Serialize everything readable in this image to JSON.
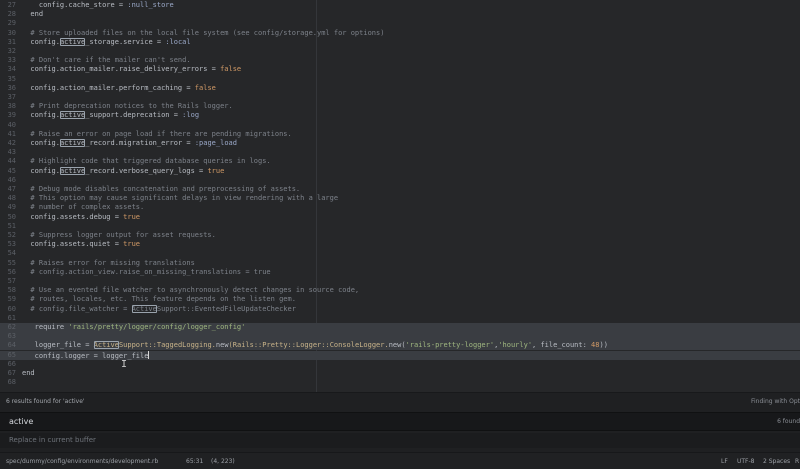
{
  "editor": {
    "lines": [
      {
        "num": "27",
        "tokens": [
          {
            "t": "    config.",
            "c": "c-default"
          },
          {
            "t": "cache_store",
            "c": "c-default"
          },
          {
            "t": " = ",
            "c": "c-default"
          },
          {
            "t": ":null_store",
            "c": "c-symbol"
          }
        ]
      },
      {
        "num": "28",
        "tokens": [
          {
            "t": "  end",
            "c": "c-default"
          }
        ]
      },
      {
        "num": "29",
        "tokens": []
      },
      {
        "num": "30",
        "tokens": [
          {
            "t": "  # Store uploaded files on the local file system (see config/storage.yml for options)",
            "c": "c-comment"
          }
        ]
      },
      {
        "num": "31",
        "tokens": [
          {
            "t": "  config.",
            "c": "c-default"
          },
          {
            "t": "active",
            "c": "c-default",
            "m": true
          },
          {
            "t": "_storage.service = ",
            "c": "c-default"
          },
          {
            "t": ":local",
            "c": "c-symbol"
          }
        ]
      },
      {
        "num": "32",
        "tokens": []
      },
      {
        "num": "33",
        "tokens": [
          {
            "t": "  # Don't care if the mailer can't send.",
            "c": "c-comment"
          }
        ]
      },
      {
        "num": "34",
        "tokens": [
          {
            "t": "  config.action_mailer.raise_delivery_errors = ",
            "c": "c-default"
          },
          {
            "t": "false",
            "c": "c-bool"
          }
        ]
      },
      {
        "num": "35",
        "tokens": []
      },
      {
        "num": "36",
        "tokens": [
          {
            "t": "  config.action_mailer.perform_caching = ",
            "c": "c-default"
          },
          {
            "t": "false",
            "c": "c-bool"
          }
        ]
      },
      {
        "num": "37",
        "tokens": []
      },
      {
        "num": "38",
        "tokens": [
          {
            "t": "  # Print deprecation notices to the Rails logger.",
            "c": "c-comment"
          }
        ]
      },
      {
        "num": "39",
        "tokens": [
          {
            "t": "  config.",
            "c": "c-default"
          },
          {
            "t": "active",
            "c": "c-default",
            "m": true
          },
          {
            "t": "_support.deprecation = ",
            "c": "c-default"
          },
          {
            "t": ":log",
            "c": "c-symbol"
          }
        ]
      },
      {
        "num": "40",
        "tokens": []
      },
      {
        "num": "41",
        "tokens": [
          {
            "t": "  # Raise an error on page load if there are pending migrations.",
            "c": "c-comment"
          }
        ]
      },
      {
        "num": "42",
        "tokens": [
          {
            "t": "  config.",
            "c": "c-default"
          },
          {
            "t": "active",
            "c": "c-default",
            "m": true
          },
          {
            "t": "_record.migration_error = ",
            "c": "c-default"
          },
          {
            "t": ":page_load",
            "c": "c-symbol"
          }
        ]
      },
      {
        "num": "43",
        "tokens": []
      },
      {
        "num": "44",
        "tokens": [
          {
            "t": "  # Highlight code that triggered database queries in logs.",
            "c": "c-comment"
          }
        ]
      },
      {
        "num": "45",
        "tokens": [
          {
            "t": "  config.",
            "c": "c-default"
          },
          {
            "t": "active",
            "c": "c-default",
            "m": true
          },
          {
            "t": "_record.verbose_query_logs = ",
            "c": "c-default"
          },
          {
            "t": "true",
            "c": "c-bool"
          }
        ]
      },
      {
        "num": "46",
        "tokens": []
      },
      {
        "num": "47",
        "tokens": [
          {
            "t": "  # Debug mode disables concatenation and preprocessing of assets.",
            "c": "c-comment"
          }
        ]
      },
      {
        "num": "48",
        "tokens": [
          {
            "t": "  # This option may cause significant delays in view rendering with a large",
            "c": "c-comment"
          }
        ]
      },
      {
        "num": "49",
        "tokens": [
          {
            "t": "  # number of complex assets.",
            "c": "c-comment"
          }
        ]
      },
      {
        "num": "50",
        "tokens": [
          {
            "t": "  config.assets.debug = ",
            "c": "c-default"
          },
          {
            "t": "true",
            "c": "c-bool"
          }
        ]
      },
      {
        "num": "51",
        "tokens": []
      },
      {
        "num": "52",
        "tokens": [
          {
            "t": "  # Suppress logger output for asset requests.",
            "c": "c-comment"
          }
        ]
      },
      {
        "num": "53",
        "tokens": [
          {
            "t": "  config.assets.quiet = ",
            "c": "c-default"
          },
          {
            "t": "true",
            "c": "c-bool"
          }
        ]
      },
      {
        "num": "54",
        "tokens": []
      },
      {
        "num": "55",
        "tokens": [
          {
            "t": "  # Raises error for missing translations",
            "c": "c-comment"
          }
        ]
      },
      {
        "num": "56",
        "tokens": [
          {
            "t": "  # config.action_view.raise_on_missing_translations = true",
            "c": "c-comment"
          }
        ]
      },
      {
        "num": "57",
        "tokens": []
      },
      {
        "num": "58",
        "tokens": [
          {
            "t": "  # Use an evented file watcher to asynchronously detect changes in source code,",
            "c": "c-comment"
          }
        ]
      },
      {
        "num": "59",
        "tokens": [
          {
            "t": "  # routes, locales, etc. This feature depends on the listen gem.",
            "c": "c-comment"
          }
        ]
      },
      {
        "num": "60",
        "tokens": [
          {
            "t": "  # config.file_watcher = ",
            "c": "c-comment"
          },
          {
            "t": "Active",
            "c": "c-comment",
            "m": true
          },
          {
            "t": "Support::EventedFileUpdateChecker",
            "c": "c-comment"
          }
        ]
      },
      {
        "num": "61",
        "tokens": []
      },
      {
        "num": "62",
        "hl": true,
        "tokens": [
          {
            "t": "   require ",
            "c": "c-default"
          },
          {
            "t": "'rails/pretty/logger/config/logger_config'",
            "c": "c-str"
          }
        ]
      },
      {
        "num": "63",
        "hl": true,
        "tokens": []
      },
      {
        "num": "64",
        "hl": true,
        "tokens": [
          {
            "t": "   logger_file = ",
            "c": "c-default"
          },
          {
            "t": "Active",
            "c": "c-const",
            "m": true
          },
          {
            "t": "Support::TaggedLogging.",
            "c": "c-const"
          },
          {
            "t": "new",
            "c": "c-default"
          },
          {
            "t": "(Rails::Pretty::Logger::ConsoleLogger.",
            "c": "c-const"
          },
          {
            "t": "new",
            "c": "c-default"
          },
          {
            "t": "(",
            "c": "c-default"
          },
          {
            "t": "'rails-pretty-logger'",
            "c": "c-str"
          },
          {
            "t": ",",
            "c": "c-default"
          },
          {
            "t": "'hourly'",
            "c": "c-str"
          },
          {
            "t": ", file_count: ",
            "c": "c-default"
          },
          {
            "t": "48",
            "c": "c-num"
          },
          {
            "t": "))",
            "c": "c-default"
          }
        ]
      },
      {
        "num": "65",
        "hl": true,
        "cursor": true,
        "tokens": [
          {
            "t": "   config.logger = logger_file",
            "c": "c-default"
          }
        ]
      },
      {
        "num": "66",
        "tokens": []
      },
      {
        "num": "67",
        "tokens": [
          {
            "t": "end",
            "c": "c-default"
          }
        ]
      },
      {
        "num": "68",
        "tokens": []
      }
    ]
  },
  "find": {
    "results_summary": "6 results found for 'active'",
    "mode_label": "Finding with Opt",
    "query": "active",
    "count": "6 found",
    "replace_placeholder": "Replace in current buffer"
  },
  "status": {
    "path": "spec/dummy/config/environments/development.rb",
    "position": "65:31",
    "selection": "(4, 223)",
    "line_ending": "LF",
    "encoding": "UTF-8",
    "indent": "2 Spaces",
    "grammar": "R"
  }
}
